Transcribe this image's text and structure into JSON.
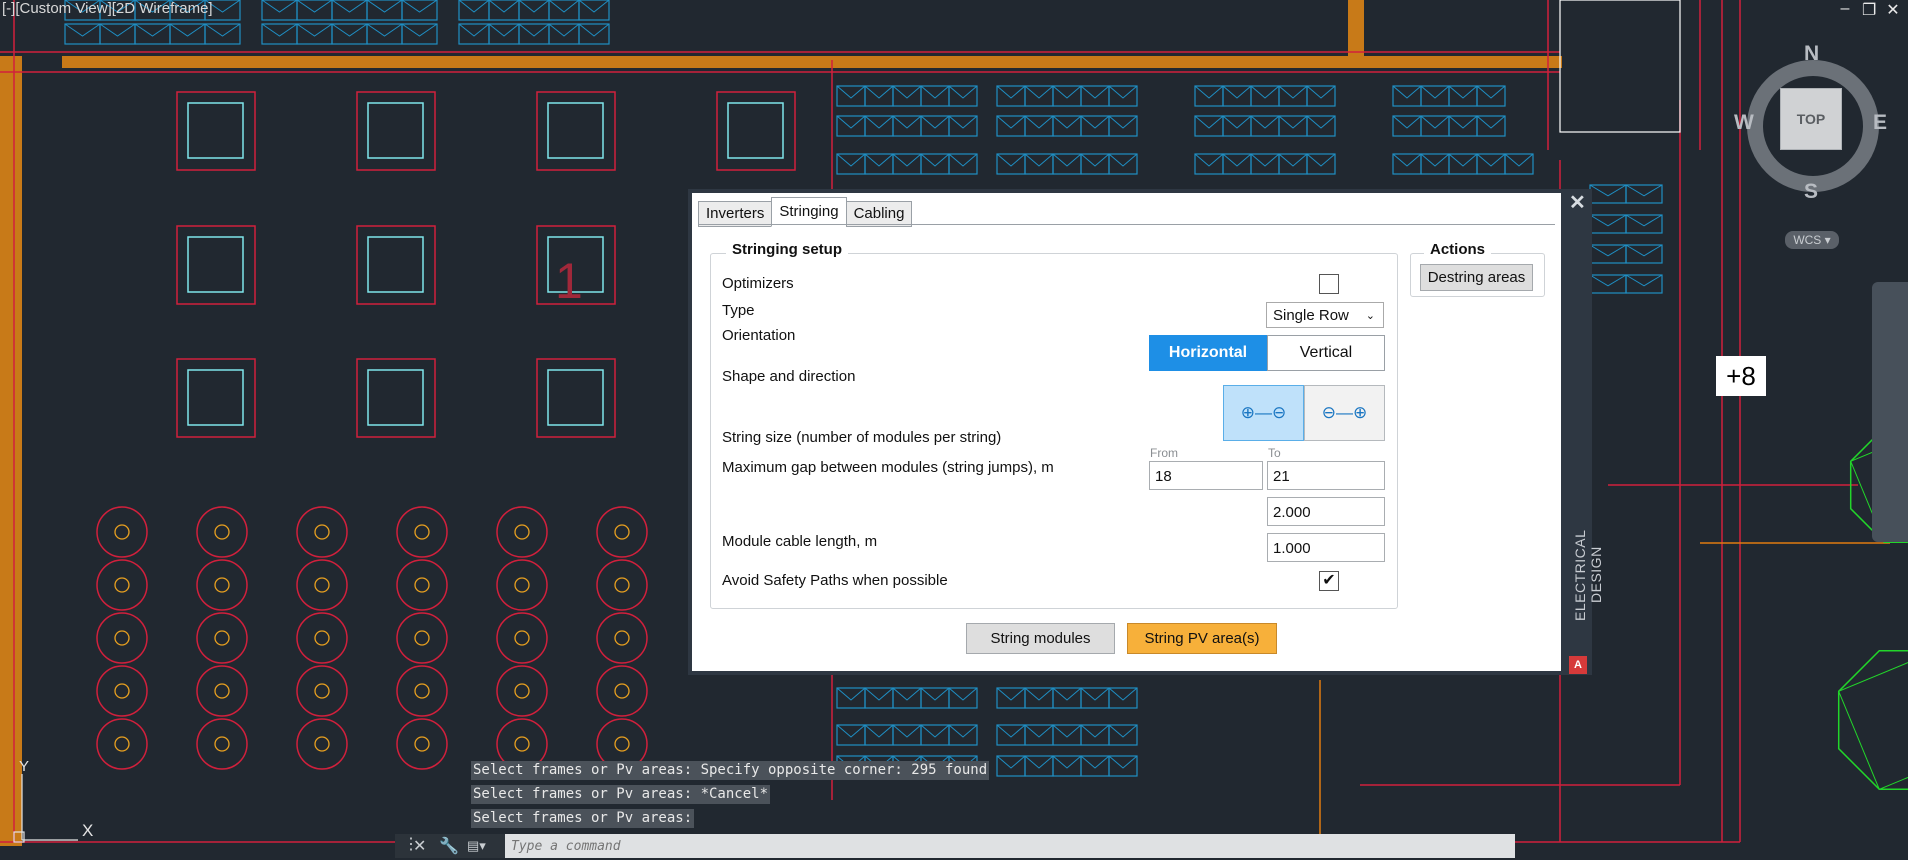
{
  "viewport": {
    "label": "[-][Custom View][2D Wireframe]",
    "window_controls": [
      "–",
      "❐",
      "✕"
    ]
  },
  "viewcube": {
    "north": "N",
    "south": "S",
    "east": "E",
    "west": "W",
    "face": "TOP",
    "wcs_label": "WCS ▾"
  },
  "overlay_badge": "+8",
  "drawing_marker": "1",
  "ucs": {
    "y": "Y",
    "x": "X"
  },
  "dialog": {
    "close": "✕",
    "tabs": [
      "Inverters",
      "Stringing",
      "Cabling"
    ],
    "active_tab": "Stringing",
    "sidebar_title": "ELECTRICAL DESIGN",
    "sidebar_logo": "A",
    "setup": {
      "title": "Stringing setup",
      "optimizers_label": "Optimizers",
      "optimizers_checked": false,
      "type_label": "Type",
      "type_value": "Single Row",
      "orientation_label": "Orientation",
      "orientation_options": [
        "Horizontal",
        "Vertical"
      ],
      "orientation_selected": "Horizontal",
      "shape_label": "Shape and direction",
      "shape_options": [
        "⊕—⊖",
        "⊖—⊕"
      ],
      "string_size_label": "String size (number of modules per string)",
      "from_label": "From",
      "to_label": "To",
      "from_value": "18",
      "to_value": "21",
      "max_gap_label": "Maximum gap between modules (string jumps), m",
      "max_gap_value": "2.000",
      "cable_length_label": "Module cable length, m",
      "cable_length_value": "1.000",
      "avoid_label": "Avoid Safety Paths when possible",
      "avoid_checked": true,
      "check_mark": "✔"
    },
    "actions": {
      "title": "Actions",
      "destring_label": "Destring areas"
    },
    "string_modules_label": "String modules",
    "string_pv_label": "String PV area(s)"
  },
  "command_line": {
    "history": [
      "Select frames or Pv areas: Specify opposite corner: 295 found",
      "Select frames or Pv areas: *Cancel*",
      "Select frames or Pv areas:"
    ],
    "placeholder": "Type a command"
  },
  "colors": {
    "background": "#212830",
    "red_lines": "#d1203c",
    "cyan": "#7fe6ea",
    "blue_modules": "#1f8fc4",
    "orange": "#c87a18",
    "accent": "#1e8fe6",
    "pv_button": "#f7b03a"
  }
}
